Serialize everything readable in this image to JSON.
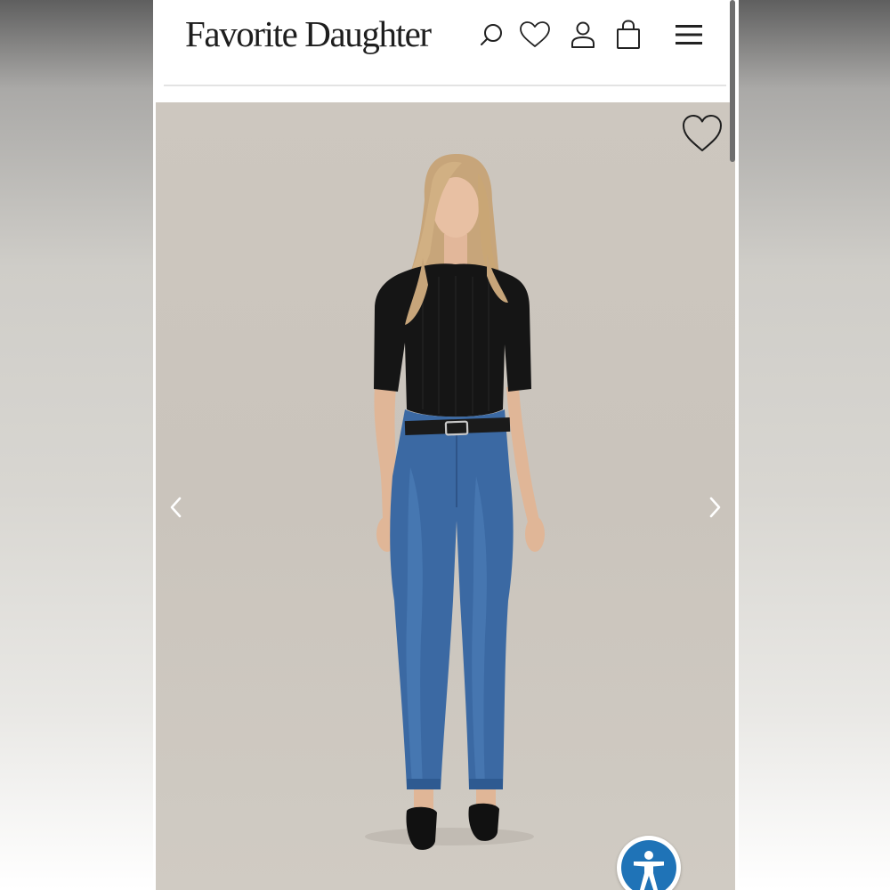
{
  "header": {
    "logo": "Favorite Daughter",
    "icons": [
      "search-icon",
      "wishlist-heart-icon",
      "account-icon",
      "shopping-bag-icon",
      "menu-icon"
    ]
  },
  "gallery": {
    "image_alt": "Model wearing black short-sleeve top and medium wash high-rise straight jeans",
    "controls": [
      "favorite-heart-icon",
      "chevron-left-icon",
      "chevron-right-icon"
    ]
  },
  "accessibility": {
    "icon": "accessibility-icon",
    "color": "#1f73b7"
  },
  "colors": {
    "text": "#1e1e1e",
    "photo_background": "#cbc5bd",
    "accent": "#1f73b7"
  }
}
